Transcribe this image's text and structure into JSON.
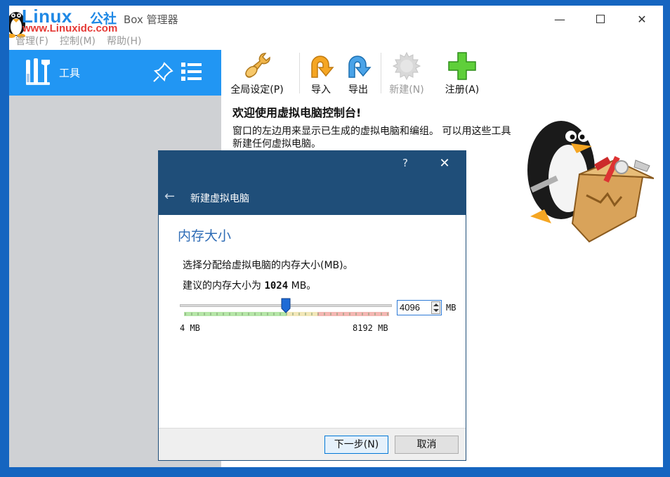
{
  "window": {
    "title": "Box 管理器",
    "minimize": "—",
    "close": "✕"
  },
  "watermark": {
    "brand": "Linux",
    "brand_cn": "公社",
    "url": "www.Linuxidc.com"
  },
  "menu": [
    "管理(F)",
    "控制(M)",
    "帮助(H)"
  ],
  "sidebar": {
    "tools_label": "工具"
  },
  "toolbar": {
    "buttons": [
      {
        "label": "全局设定(P)",
        "icon": "wrench-icon",
        "enabled": true
      },
      {
        "label": "导入",
        "icon": "import-arrow-icon",
        "enabled": true
      },
      {
        "label": "导出",
        "icon": "export-arrow-icon",
        "enabled": true
      },
      {
        "label": "新建(N)",
        "icon": "new-gear-icon",
        "enabled": false
      },
      {
        "label": "注册(A)",
        "icon": "add-plus-icon",
        "enabled": true
      }
    ]
  },
  "welcome": {
    "title": "欢迎使用虚拟电脑控制台!",
    "text": "窗口的左边用来显示已生成的虚拟电脑和编组。 可以用这些工具新建任何虚拟电脑。"
  },
  "dialog": {
    "help": "?",
    "close": "✕",
    "back": "←",
    "title": "新建虚拟电脑",
    "section": "内存大小",
    "line1": "选择分配给虚拟电脑的内存大小(MB)。",
    "line2_prefix": "建议的内存大小为 ",
    "line2_value": "1024",
    "line2_suffix": " MB。",
    "memory": {
      "value": "4096",
      "unit": "MB",
      "min_label": "4 MB",
      "max_label": "8192 MB",
      "min": 4,
      "max": 8192,
      "current": 4096
    },
    "next_button": "下一步(N)",
    "cancel_button": "取消"
  },
  "colors": {
    "desktop": "#1565c0",
    "sidebar_selected": "#2196f3",
    "dialog_header": "#1f4e79",
    "section_title": "#2d6bb5"
  }
}
